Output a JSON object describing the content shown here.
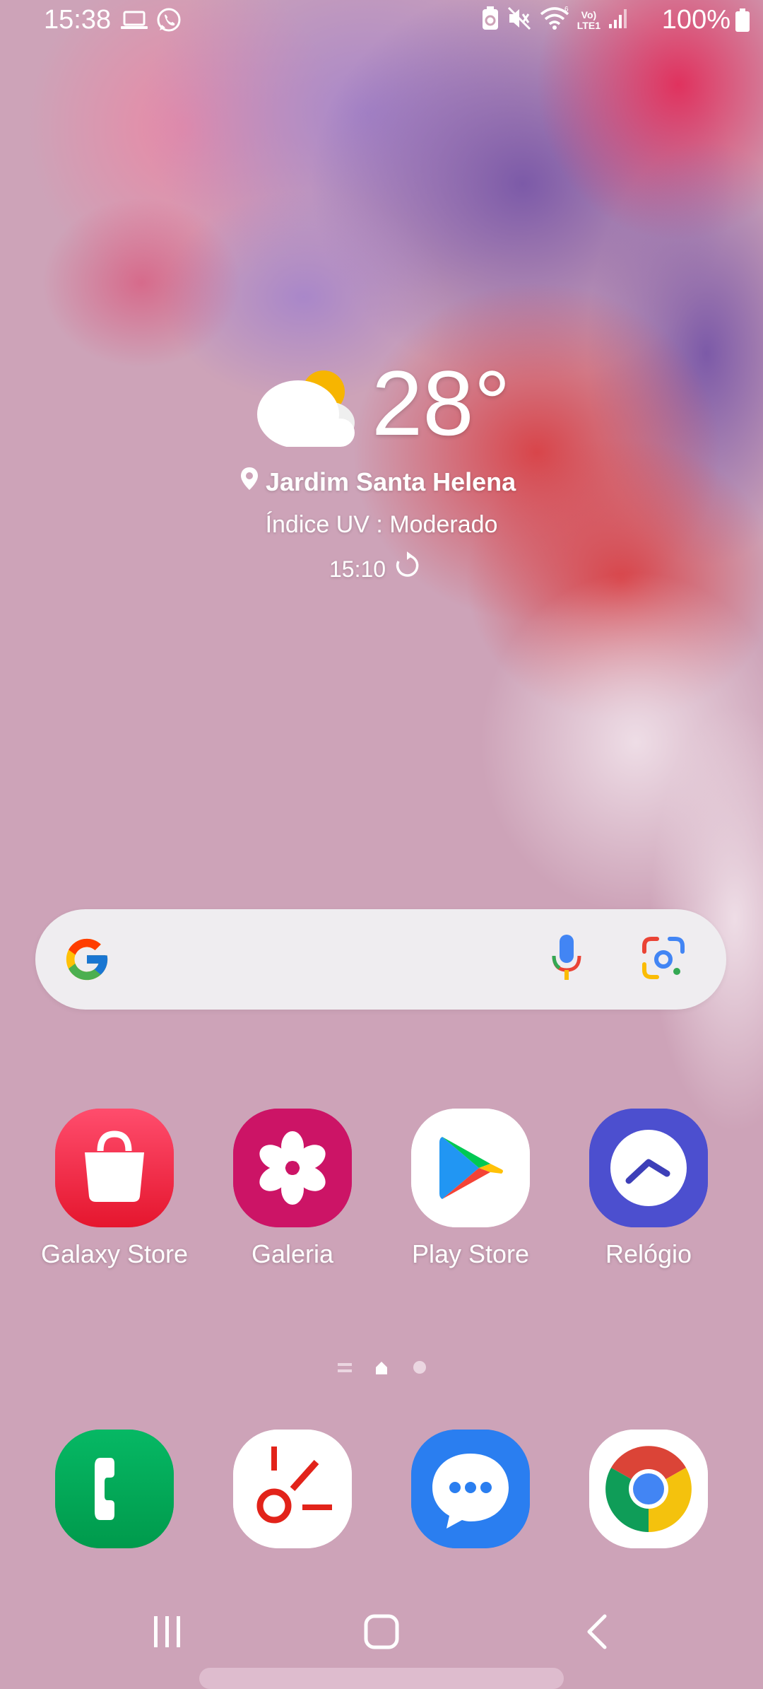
{
  "status_bar": {
    "time": "15:38",
    "battery_percent": "100%",
    "lte_label_top": "Vo)",
    "lte_label_bottom": "LTE1",
    "notification_icons": [
      "laptop-icon",
      "whatsapp-icon"
    ],
    "system_icons": [
      "battery-saver-icon",
      "mute-icon",
      "wifi-icon",
      "volte-icon",
      "signal-icon",
      "battery-icon"
    ]
  },
  "weather": {
    "temperature": "28°",
    "location": "Jardim Santa Helena",
    "uv_index": "Índice UV : Moderado",
    "updated_time": "15:10",
    "condition_icon": "partly-cloudy-icon"
  },
  "search": {
    "logo": "google-g-icon",
    "mic_icon": "microphone-icon",
    "lens_icon": "google-lens-icon"
  },
  "apps": [
    {
      "label": "Galaxy Store",
      "icon": "shopping-bag-icon",
      "color": "#f2335a"
    },
    {
      "label": "Galeria",
      "icon": "flower-icon",
      "color": "#cc1466"
    },
    {
      "label": "Play Store",
      "icon": "play-store-icon",
      "color": "#ffffff"
    },
    {
      "label": "Relógio",
      "icon": "clock-icon",
      "color": "#4c4fcf"
    }
  ],
  "dock": [
    {
      "icon": "phone-icon",
      "color": "#00a656"
    },
    {
      "icon": "sleep-routine-icon",
      "color": "#ffffff"
    },
    {
      "icon": "messages-icon",
      "color": "#2a7ef0"
    },
    {
      "icon": "chrome-icon",
      "color": "#ffffff"
    }
  ],
  "page_indicator": {
    "pages": 3,
    "current": 2
  },
  "nav": {
    "recents_icon": "recents-icon",
    "home_icon": "home-icon",
    "back_icon": "back-icon"
  }
}
